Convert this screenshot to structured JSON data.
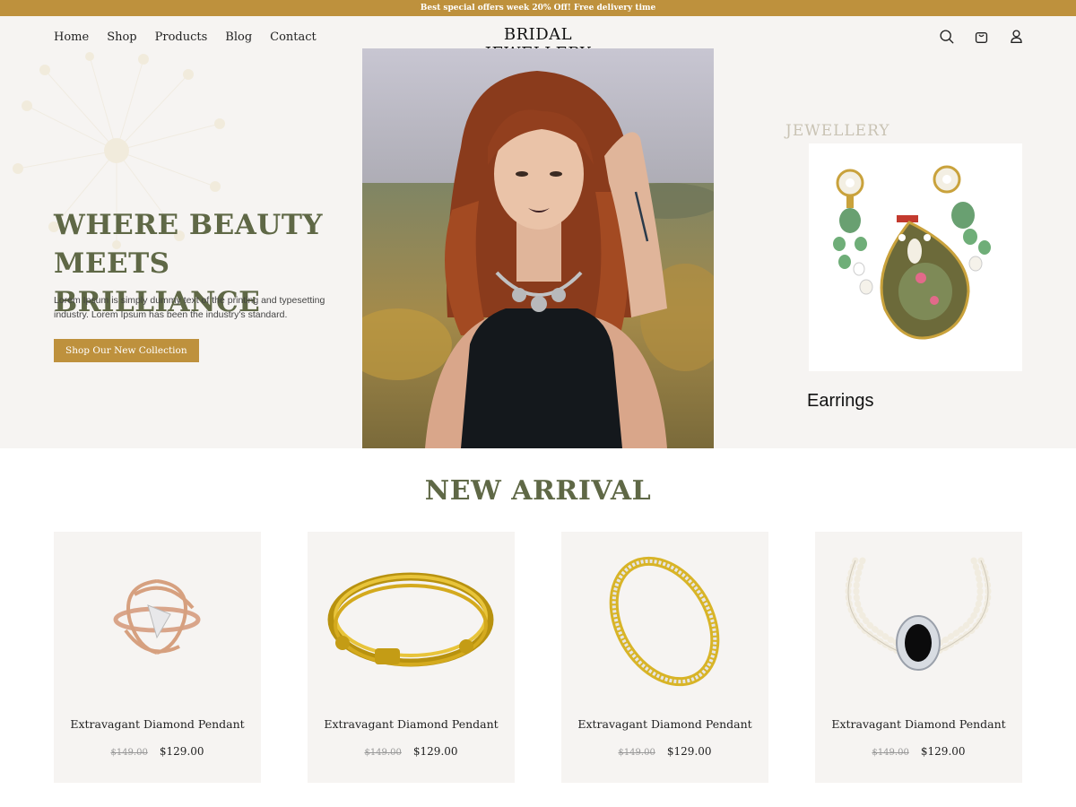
{
  "topbar": {
    "text": "Best special offers week 20% Off! Free delivery time"
  },
  "nav": {
    "items": [
      {
        "label": "Home"
      },
      {
        "label": "Shop"
      },
      {
        "label": "Products"
      },
      {
        "label": "Blog"
      },
      {
        "label": "Contact"
      }
    ]
  },
  "brand": {
    "name": "BRIDAL JEWELLERY"
  },
  "header_icons": [
    "search-icon",
    "shopping-bag-icon",
    "user-icon"
  ],
  "hero": {
    "title": "WHERE BEAUTY\nMEETS BRILLIANCE",
    "description": "Lorem Ipsum is simply dummy text of the printing and typesetting industry. Lorem Ipsum has been the industry's standard.",
    "cta_label": "Shop Our New Collection",
    "side_label": "JEWELLERY",
    "side_caption": "Earrings"
  },
  "new_arrival": {
    "title": "NEW ARRIVAL",
    "products": [
      {
        "name": "Extravagant Diamond Pendant",
        "old_price": "$149.00",
        "price": "$129.00",
        "image": "rose-gold-ring"
      },
      {
        "name": "Extravagant Diamond Pendant",
        "old_price": "$149.00",
        "price": "$129.00",
        "image": "gold-bangle"
      },
      {
        "name": "Extravagant Diamond Pendant",
        "old_price": "$149.00",
        "price": "$129.00",
        "image": "diamond-gold-bangle"
      },
      {
        "name": "Extravagant Diamond Pendant",
        "old_price": "$149.00",
        "price": "$129.00",
        "image": "pearl-choker-necklace"
      }
    ]
  },
  "colors": {
    "accent": "#be913d",
    "heading": "#5f6846",
    "hero_bg": "#f6f4f2",
    "card_bg": "#f6f4f2"
  }
}
